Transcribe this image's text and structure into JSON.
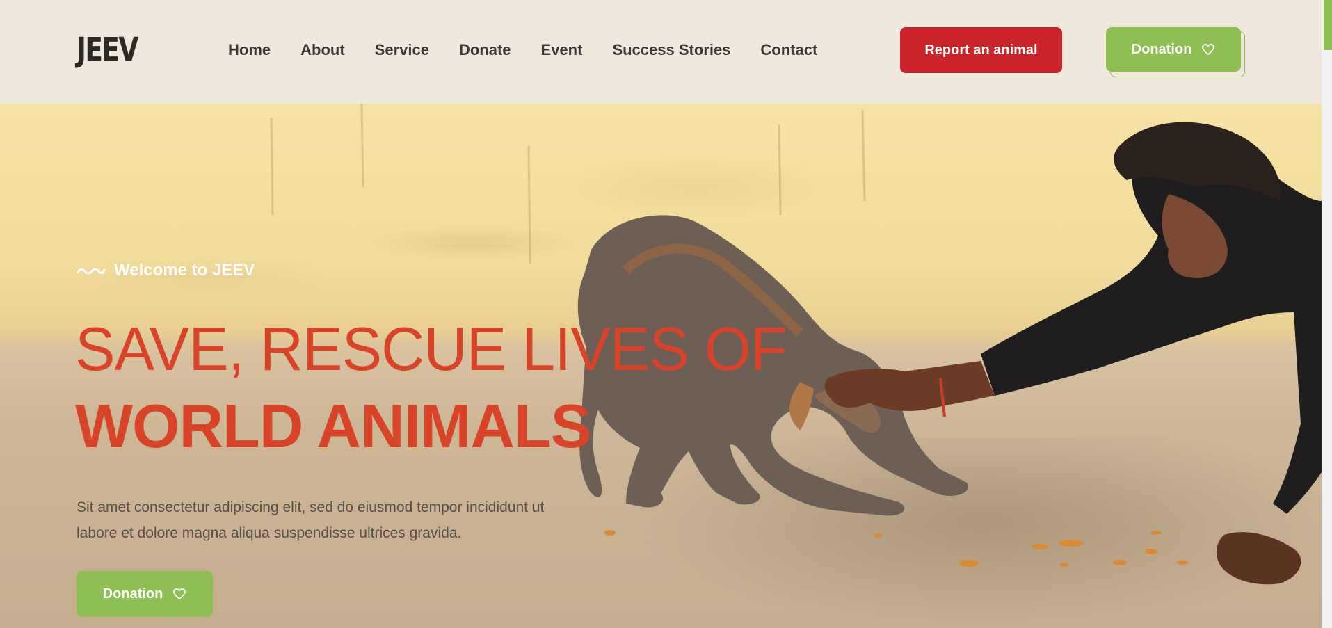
{
  "header": {
    "logo": "JEEV",
    "nav": [
      {
        "label": "Home"
      },
      {
        "label": "About"
      },
      {
        "label": "Service"
      },
      {
        "label": "Donate"
      },
      {
        "label": "Event"
      },
      {
        "label": "Success Stories"
      },
      {
        "label": "Contact"
      }
    ],
    "report_label": "Report an animal",
    "donation_label": "Donation",
    "heart_icon": "heart-outline-icon"
  },
  "hero": {
    "welcome": "Welcome to JEEV",
    "wave_icon": "wave-icon",
    "headline_line1": "SAVE, RESCUE LIVES OF",
    "headline_line2": "WORLD ANIMALS",
    "body": "Sit amet consectetur adipiscing elit, sed do eiusmod tempor incididunt ut labore et dolore magna aliqua suspendisse ultrices gravida.",
    "donation_label": "Donation"
  },
  "colors": {
    "header_bg": "#f0e8dd",
    "brand_red": "#cc2229",
    "brand_green": "#8fbe55",
    "headline": "#d8432a",
    "nav_text": "#3b3835"
  }
}
